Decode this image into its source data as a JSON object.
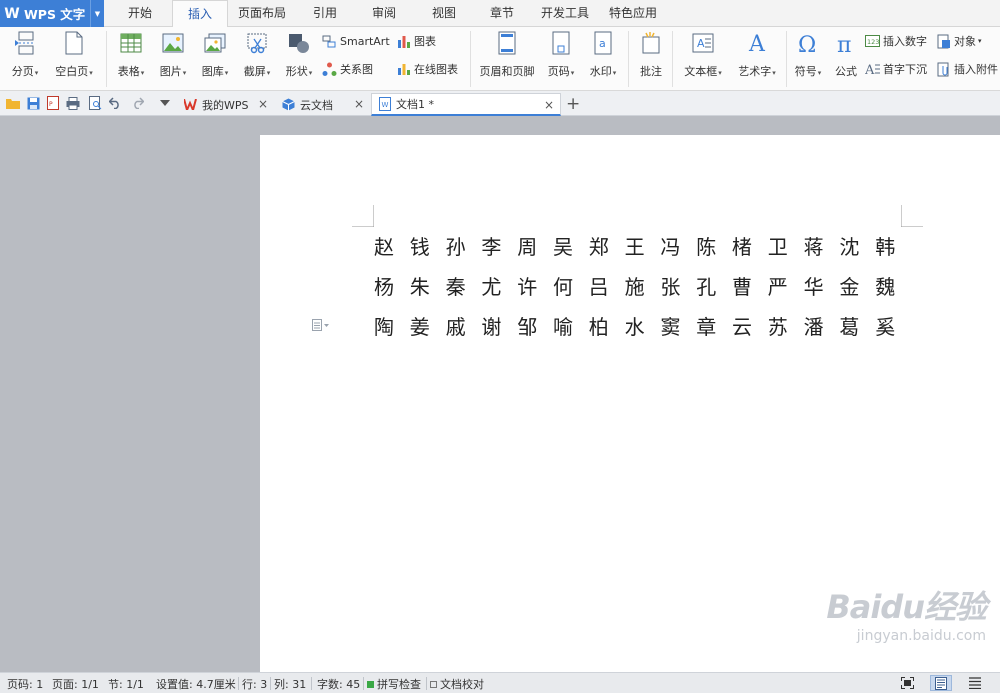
{
  "app": {
    "name": "WPS 文字"
  },
  "menu": {
    "tabs": [
      {
        "label": "开始"
      },
      {
        "label": "插入"
      },
      {
        "label": "页面布局"
      },
      {
        "label": "引用"
      },
      {
        "label": "审阅"
      },
      {
        "label": "视图"
      },
      {
        "label": "章节"
      },
      {
        "label": "开发工具"
      },
      {
        "label": "特色应用"
      }
    ],
    "active": "插入"
  },
  "ribbon": {
    "page_break": "分页",
    "blank_page": "空白页",
    "table": "表格",
    "picture": "图片",
    "gallery": "图库",
    "screenshot": "截屏",
    "shapes": "形状",
    "smartart": "SmartArt",
    "chart": "图表",
    "relation_chart": "关系图",
    "online_chart": "在线图表",
    "header_footer": "页眉和页脚",
    "page_number": "页码",
    "watermark": "水印",
    "comment": "批注",
    "textbox": "文本框",
    "wordart": "艺术字",
    "symbol": "符号",
    "formula": "公式",
    "insert_number": "插入数字",
    "object": "对象",
    "drop_cap": "首字下沉",
    "insert_attachment": "插入附件",
    "dropdown_glyph": "▾"
  },
  "tabs": {
    "my_wps": "我的WPS",
    "cloud_docs": "云文档",
    "document": "文档1 *",
    "close_glyph": "×",
    "new_tab_glyph": "+"
  },
  "document": {
    "lines": [
      "赵钱孙李周吴郑王冯陈楮卫蒋沈韩",
      "杨朱秦尤许何吕施张孔曹严华金魏",
      "陶姜戚谢邹喻柏水窦章云苏潘葛奚"
    ]
  },
  "status": {
    "page_no": "页码: 1",
    "pages": "页面: 1/1",
    "section": "节: 1/1",
    "setting": "设置值: 4.7厘米",
    "row": "行: 3",
    "col": "列: 31",
    "word_count": "字数: 45",
    "spell_check": "拼写检查",
    "doc_proof": "文档校对"
  },
  "watermark": {
    "brand": "Baidu经验",
    "url": "jingyan.baidu.com"
  },
  "colors": {
    "accent": "#3d7fd6",
    "page_bg": "#ffffff",
    "workspace_bg": "#b9bcc2"
  }
}
